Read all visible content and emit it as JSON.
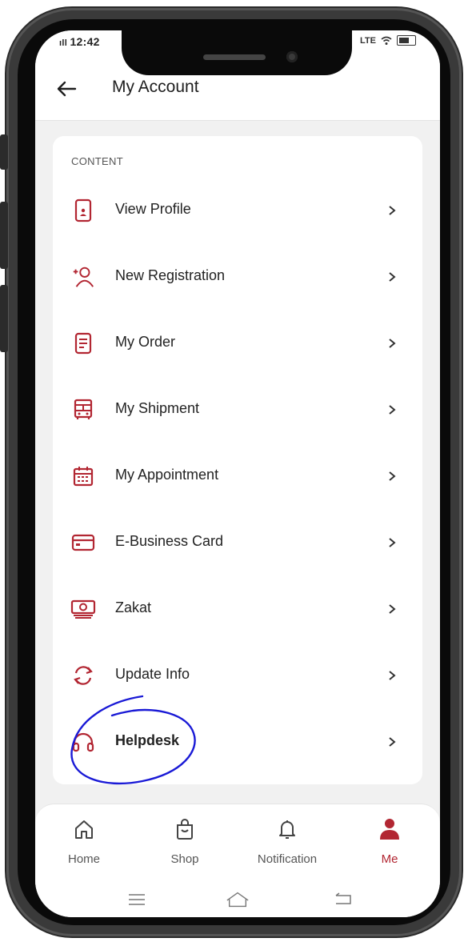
{
  "status_bar": {
    "time": "12:42",
    "signal": "▪ıll"
  },
  "header": {
    "title": "My Account"
  },
  "content": {
    "section_label": "CONTENT",
    "items": [
      {
        "label": "View Profile",
        "icon": "profile-phone-icon"
      },
      {
        "label": "New Registration",
        "icon": "add-user-icon"
      },
      {
        "label": "My Order",
        "icon": "order-document-icon"
      },
      {
        "label": "My Shipment",
        "icon": "bus-shipment-icon"
      },
      {
        "label": "My Appointment",
        "icon": "calendar-icon"
      },
      {
        "label": "E-Business Card",
        "icon": "card-icon"
      },
      {
        "label": "Zakat",
        "icon": "cash-icon"
      },
      {
        "label": "Update Info",
        "icon": "refresh-icon"
      },
      {
        "label": "Helpdesk",
        "icon": "headphones-icon"
      }
    ]
  },
  "bottom_nav": {
    "items": [
      {
        "label": "Home",
        "icon": "home-icon"
      },
      {
        "label": "Shop",
        "icon": "shopping-bag-icon"
      },
      {
        "label": "Notification",
        "icon": "bell-icon"
      },
      {
        "label": "Me",
        "icon": "person-icon",
        "active": true
      }
    ]
  },
  "colors": {
    "accent": "#b22632",
    "annotation": "#1a1ad6"
  }
}
